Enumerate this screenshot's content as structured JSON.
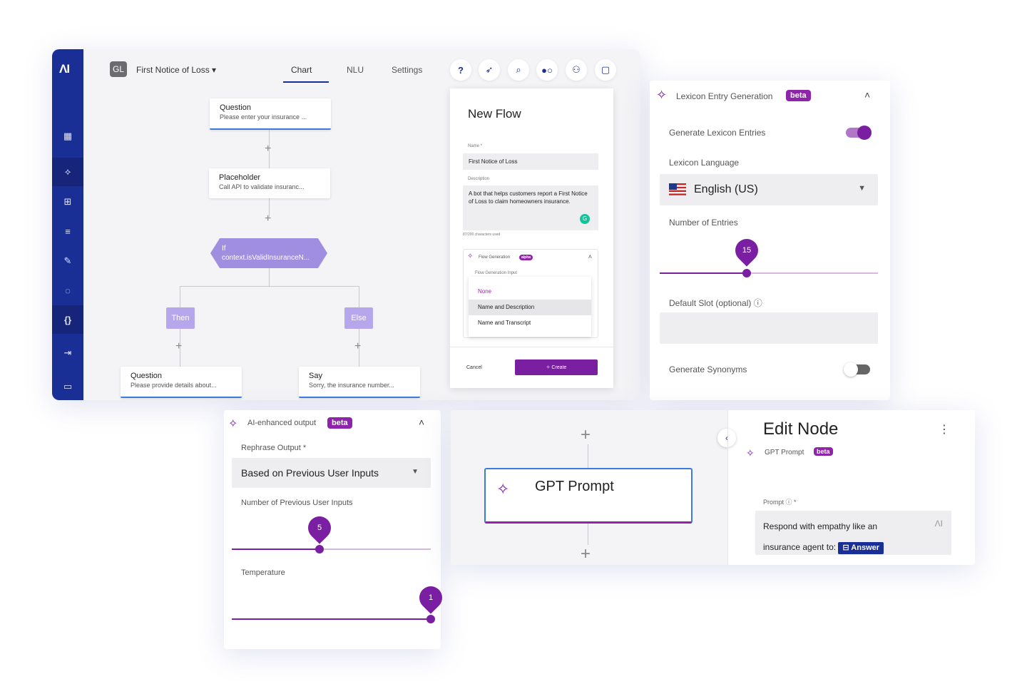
{
  "app": {
    "logo": "ΛI",
    "flow_badge": "GL",
    "flow_name": "First Notice of Loss",
    "tabs": [
      "Chart",
      "NLU",
      "Settings"
    ],
    "toolbar_icons": [
      "help-icon",
      "compass-icon",
      "search-icon",
      "toggle-view-icon",
      "user-icon",
      "chat-icon"
    ],
    "sidebar_icons": [
      "grid-icon",
      "rocket-icon",
      "flow-icon",
      "list-icon",
      "wrench-icon",
      "bulb-icon",
      "braces-icon",
      "exit-icon",
      "messages-icon"
    ]
  },
  "chart": {
    "node1": {
      "title": "Question",
      "subtitle": "Please enter your insurance ..."
    },
    "node2": {
      "title": "Placeholder",
      "subtitle": "Call API to validate insuranc..."
    },
    "if_node": {
      "title": "If",
      "subtitle": "context.isValidInsuranceN..."
    },
    "then_label": "Then",
    "else_label": "Else",
    "node3": {
      "title": "Question",
      "subtitle": "Please provide details about..."
    },
    "node4": {
      "title": "Say",
      "subtitle": "Sorry, the insurance number..."
    },
    "plus": "+"
  },
  "new_flow": {
    "title": "New Flow",
    "name_label": "Name *",
    "name_value": "First Notice of Loss",
    "description_label": "Description",
    "description_value": "A bot that helps customers report a First Notice of Loss to claim homeowners insurance.",
    "char_count": "87/200 characters used",
    "flow_generation_label": "Flow Generation",
    "flow_generation_badge": "alpha",
    "flow_generation_input_label": "Flow Generation Input",
    "options": [
      "None",
      "Name and Description",
      "Name and Transcript"
    ],
    "cancel_label": "Cancel",
    "create_label": "Create"
  },
  "lexicon": {
    "title": "Lexicon Entry Generation",
    "badge": "beta",
    "generate_label": "Generate Lexicon Entries",
    "generate_on": true,
    "language_label": "Lexicon Language",
    "language_value": "English (US)",
    "entries_label": "Number of Entries",
    "entries_value": "15",
    "entries_fraction": 0.4,
    "default_slot_label": "Default Slot (optional)",
    "synonyms_label": "Generate Synonyms",
    "synonyms_on": false
  },
  "ai_output": {
    "title": "AI-enhanced output",
    "badge": "beta",
    "rephrase_label": "Rephrase Output *",
    "rephrase_value": "Based on Previous User Inputs",
    "prev_inputs_label": "Number of Previous User Inputs",
    "prev_inputs_value": "5",
    "prev_inputs_fraction": 0.44,
    "temperature_label": "Temperature",
    "temperature_value": "1",
    "temperature_fraction": 1.0
  },
  "gpt": {
    "node_title": "GPT Prompt",
    "edit_title": "Edit Node",
    "subtitle": "GPT Prompt",
    "badge": "beta",
    "prompt_label": "Prompt",
    "prompt_text": "Respond with empathy like an insurance agent to:",
    "answer_chip": "Answer",
    "ai_mark": "ΛI"
  },
  "colors": {
    "brand_blue": "#1a2f95",
    "purple": "#7b1fa2",
    "node_blue": "#3b7be0"
  }
}
